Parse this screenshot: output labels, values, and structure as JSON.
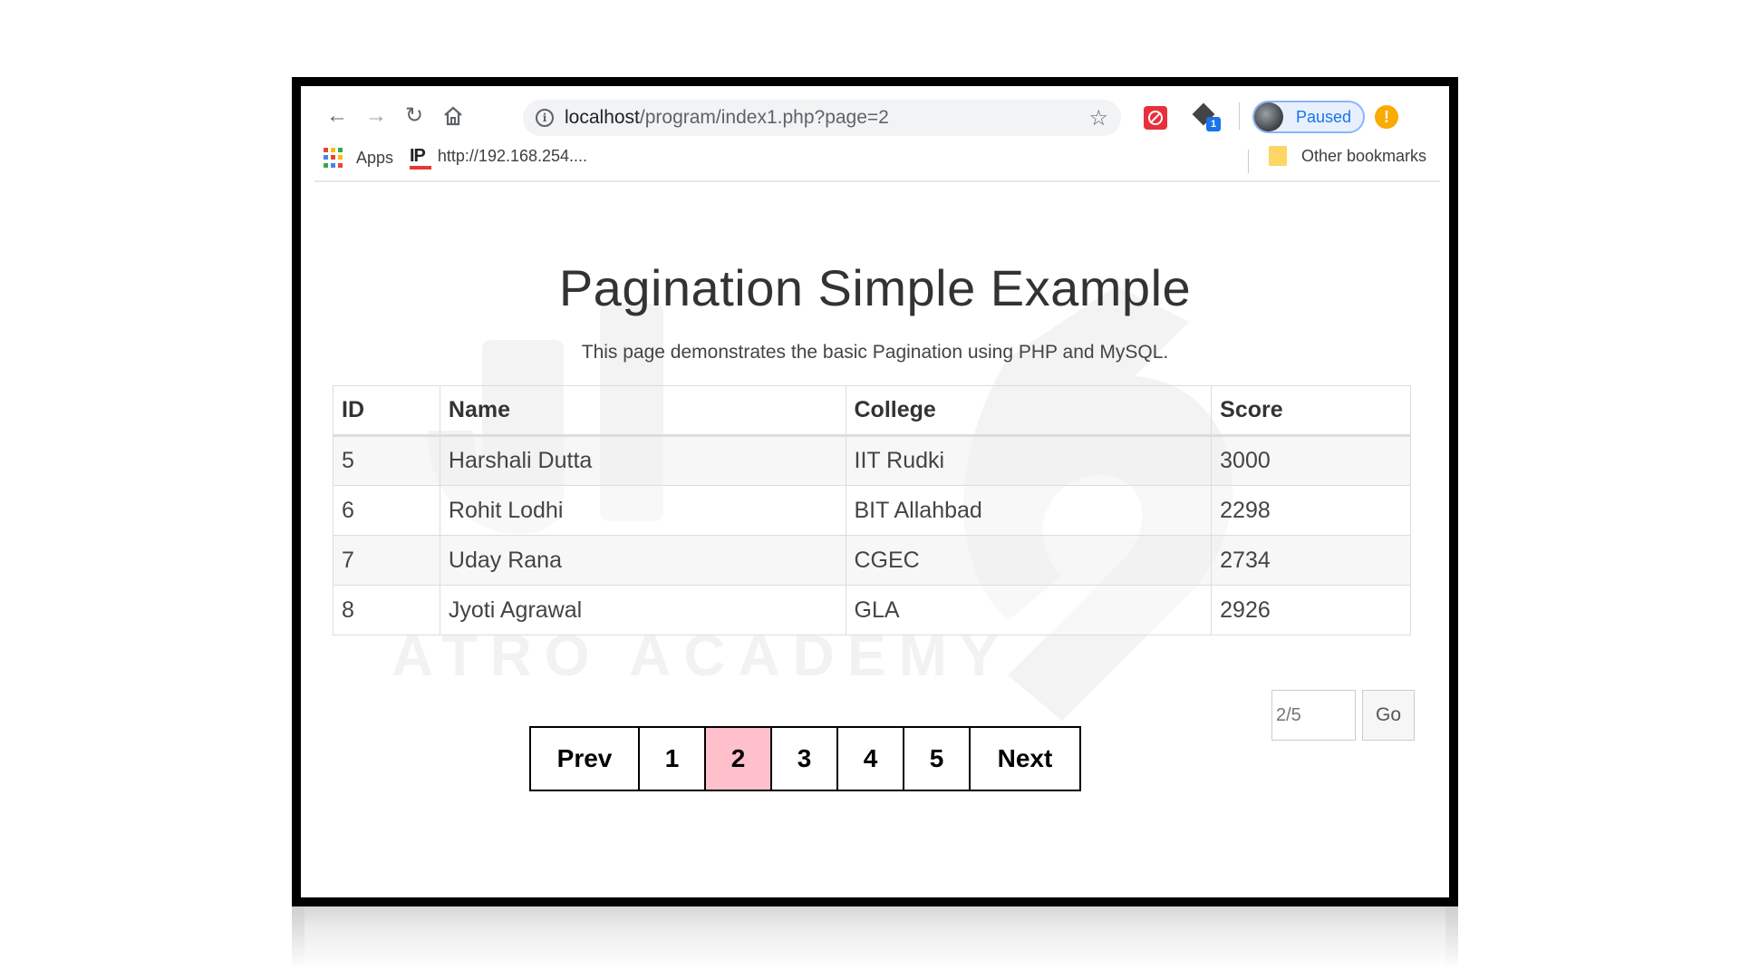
{
  "browser": {
    "url_host": "localhost",
    "url_path": "/program/index1.php?page=2",
    "profile_status": "Paused",
    "ext_badge": "1",
    "bookmarks": {
      "apps_label": "Apps",
      "ip_icon_text": "IP",
      "ip_link": "http://192.168.254....",
      "other_label": "Other bookmarks"
    }
  },
  "page": {
    "title": "Pagination Simple Example",
    "description": "This page demonstrates the basic Pagination using PHP and MySQL."
  },
  "table": {
    "headers": [
      "ID",
      "Name",
      "College",
      "Score"
    ],
    "rows": [
      [
        "5",
        "Harshali Dutta",
        "IIT Rudki",
        "3000"
      ],
      [
        "6",
        "Rohit Lodhi",
        "BIT Allahbad",
        "2298"
      ],
      [
        "7",
        "Uday Rana",
        "CGEC",
        "2734"
      ],
      [
        "8",
        "Jyoti Agrawal",
        "GLA",
        "2926"
      ]
    ]
  },
  "goto": {
    "placeholder": "2/5",
    "button_label": "Go"
  },
  "pagination": {
    "prev_label": "Prev",
    "next_label": "Next",
    "pages": [
      "1",
      "2",
      "3",
      "4",
      "5"
    ],
    "current": "2"
  },
  "watermark": {
    "text": "ATRO ACADEMY"
  },
  "colors": {
    "active_page": "#ffc0cb",
    "accent": "#1a73e8",
    "alert": "#f9ab00"
  }
}
